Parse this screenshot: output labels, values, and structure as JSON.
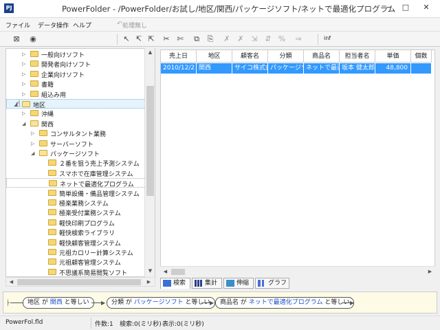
{
  "window": {
    "title": "PowerFolder - /PowerFolder/お試し/地区/関西/パッケージソフト/ネットで最適化プログラム",
    "min": "−",
    "max": "□",
    "close": "✕"
  },
  "menu": {
    "file": "ファイル",
    "data_ops": "データ操作",
    "help": "ヘルプ",
    "undo": "処理無し"
  },
  "toolbar": {
    "inf": "inf"
  },
  "tree": [
    {
      "label": "一般向けソフト",
      "level": 2,
      "arrow": "▷"
    },
    {
      "label": "開発者向けソフト",
      "level": 2,
      "arrow": "▷"
    },
    {
      "label": "企業向けソフト",
      "level": 2,
      "arrow": "▷"
    },
    {
      "label": "書籍",
      "level": 2,
      "arrow": "▷"
    },
    {
      "label": "組込み用",
      "level": 2,
      "arrow": "▷"
    },
    {
      "label": "地区",
      "level": 1,
      "arrow": "◢",
      "selected": true
    },
    {
      "label": "沖縄",
      "level": 2,
      "arrow": "▷"
    },
    {
      "label": "関西",
      "level": 2,
      "arrow": "◢"
    },
    {
      "label": "コンサルタント業務",
      "level": 3,
      "arrow": "▷"
    },
    {
      "label": "サーバーソフト",
      "level": 3,
      "arrow": "▷"
    },
    {
      "label": "パッケージソフト",
      "level": 3,
      "arrow": "◢"
    },
    {
      "label": "２番を狙う売上予測システム",
      "level": 4,
      "arrow": ""
    },
    {
      "label": "スマホで在庫管理システム",
      "level": 4,
      "arrow": ""
    },
    {
      "label": "ネットで最適化プログラム",
      "level": 4,
      "arrow": "",
      "hl": true
    },
    {
      "label": "簡単設備・備品管理システム",
      "level": 4,
      "arrow": ""
    },
    {
      "label": "極楽業務システム",
      "level": 4,
      "arrow": ""
    },
    {
      "label": "極楽受付業務システム",
      "level": 4,
      "arrow": ""
    },
    {
      "label": "軽快印刷プログラム",
      "level": 4,
      "arrow": ""
    },
    {
      "label": "軽快検索ライブラリ",
      "level": 4,
      "arrow": ""
    },
    {
      "label": "軽快顧客管理システム",
      "level": 4,
      "arrow": ""
    },
    {
      "label": "元祖カロリー計算システム",
      "level": 4,
      "arrow": ""
    },
    {
      "label": "元祖顧客管理システム",
      "level": 4,
      "arrow": ""
    },
    {
      "label": "不思議系簡易閲覧ソフト",
      "level": 4,
      "arrow": ""
    }
  ],
  "grid": {
    "headers": [
      "売上日",
      "地区",
      "顧客名",
      "分類",
      "商品名",
      "担当者名",
      "単価",
      "個数"
    ],
    "rows": [
      [
        "2010/12/2",
        "関西",
        "サイコ株式会",
        "パッケージソ",
        "ネットで最適",
        "坂本 健太郎",
        "48,800",
        ""
      ]
    ]
  },
  "tabs": [
    "検索",
    "集計",
    "伸縮",
    "グラフ"
  ],
  "filters": [
    {
      "field": "地区",
      "ga": "が",
      "value": "関西",
      "op": "と等しい"
    },
    {
      "field": "分類",
      "ga": "が",
      "value": "パッケージソフト",
      "op": "と等しい"
    },
    {
      "field": "商品名",
      "ga": "が",
      "value": "ネットで最適化プログラム",
      "op": "と等しい"
    }
  ],
  "status": {
    "file": "PowerFol.fld",
    "count": "件数:1",
    "search": "検索:0(ミリ秒)",
    "display": "表示:0(ミリ秒)"
  }
}
